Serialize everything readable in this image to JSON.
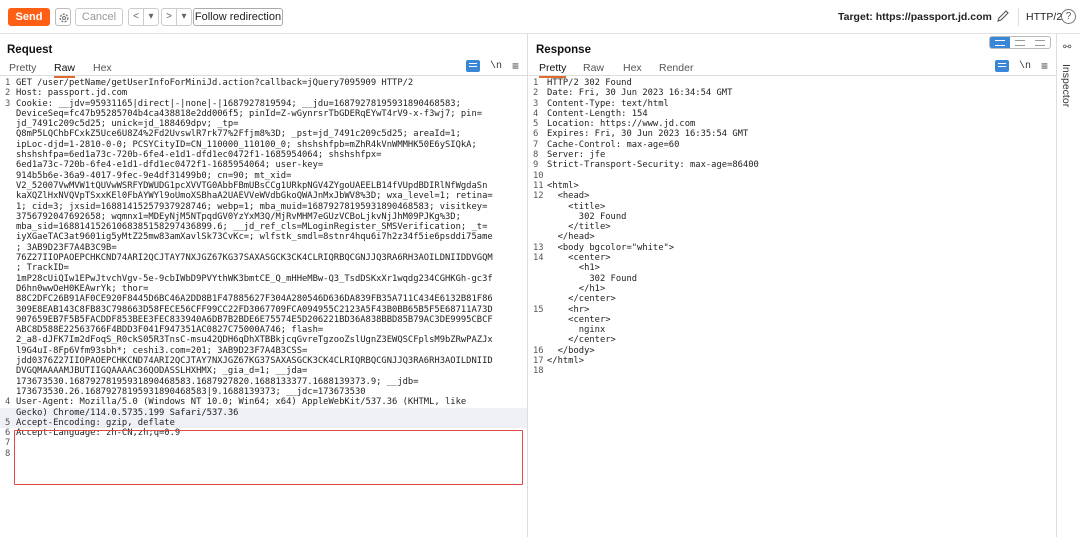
{
  "toolbar": {
    "send_label": "Send",
    "cancel_label": "Cancel",
    "back_label": "<",
    "back_dropdown": "|▾",
    "forward_label": ">",
    "forward_dropdown": "|▾",
    "follow_label": "Follow redirection",
    "target_text": "Target: https://passport.jd.com",
    "http_version": "HTTP/2",
    "help_label": "?"
  },
  "request": {
    "title": "Request",
    "tabs": [
      "Pretty",
      "Raw",
      "Hex"
    ],
    "active_tab": "Raw",
    "newline_label": "\\n",
    "menu_label": "≡",
    "lines": [
      {
        "n": "1",
        "t": "GET /user/petName/getUserInfoForMiniJd.action?callback=jQuery7095909 HTTP/2"
      },
      {
        "n": "2",
        "t": "Host: passport.jd.com"
      },
      {
        "n": "3",
        "t": "Cookie: __jdv=95931165|direct|-|none|-|1687927819594; __jdu=16879278195931890468583;"
      },
      {
        "n": "",
        "t": "DeviceSeq=fc47b95285704b4ca438818e2dd006f5; pinId=Z-wGynrsrTbGDERqEYwT4rV9-x-f3wj7; pin="
      },
      {
        "n": "",
        "t": "jd_7491c209c5d25; unick=jd_188469dpv; _tp="
      },
      {
        "n": "",
        "t": "Q8mP5LQChbFCxkZ5Uce6U8Z4%2Fd2UvswlR7rk77%2Ffjm8%3D; _pst=jd_7491c209c5d25; areaId=1;"
      },
      {
        "n": "",
        "t": "ipLoc-djd=1-2810-0-0; PCSYCityID=CN_110000_110100_0; shshshfpb=mZhR4kVnWMMHK50E6ySIQkA;"
      },
      {
        "n": "",
        "t": "shshshfpa=6ed1a73c-720b-6fe4-e1d1-dfd1ec0472f1-1685954064; shshshfpx="
      },
      {
        "n": "",
        "t": "6ed1a73c-720b-6fe4-e1d1-dfd1ec0472f1-1685954064; user-key="
      },
      {
        "n": "",
        "t": "914b5b6e-36a9-4017-9fec-9e4df31499b0; cn=90; mt_xid="
      },
      {
        "n": "",
        "t": "V2_52007VwMVW1tQUVwWSRFYDWUDG1pcXVVTG0AbbFBmUBsCCg1URkpNGV4ZYgoUAEELB14fVUpdBDIRlNfWgdaSn"
      },
      {
        "n": "",
        "t": "kaXQZlHxNVQVpTSxxKEl0FbAYWYl9oUmoXSBhaA2UAEVVeWVdbGkoQWAJnMxJbWV8%3D; wxa_level=1; retina="
      },
      {
        "n": "",
        "t": "1; cid=3; jxsid=16881415257937928746; webp=1; mba_muid=16879278195931890468583; visitkey="
      },
      {
        "n": "",
        "t": "3756792047692658; wqmnx1=MDEyNjM5NTpqdGV0YzYxM3Q/MjRvMHM7eGUzVCBoLjkvNjJhM09PJKg%3D;"
      },
      {
        "n": "",
        "t": "mba_sid=16881415261068385158297436899.6; __jd_ref_cls=MLoginRegister_SMSVerification; _t="
      },
      {
        "n": "",
        "t": "iyXGaeTAC3at9601ig5yMtZ25mw83amXavlSk73CvKc=; wlfstk_smdl=8stnr4hqu6i7h2z34f5ie6psddi75ame"
      },
      {
        "n": "",
        "t": "; 3AB9D23F7A4B3C9B="
      },
      {
        "n": "",
        "t": "76Z27IIOPAOEPCHKCND74ARI2QCJTAY7NXJGZ67KG37SAXASGCK3CK4CLRIQRBQCGNJJQ3RA6RH3AOILDNIIDDVGQM"
      },
      {
        "n": "",
        "t": "; TrackID="
      },
      {
        "n": "",
        "t": "1mP28cUiQIw1EPwJtvchVgv-5e-9cbIWbD9PVYthWK3bmtCE_Q_mHHeMBw-Q3_TsdDSKxXr1wqdg234CGHKGh-gc3f"
      },
      {
        "n": "",
        "t": "D6hn0wwOeH0KEAwrYk; thor="
      },
      {
        "n": "",
        "t": "88C2DFC26B91AF0CE920F8445D6BC46A2DD8B1F47885627F304A280546D636DA839FB35A711C434E6132B81F86"
      },
      {
        "n": "",
        "t": "309E8EAB143C8FB83C798663D58FECE56CFF99CC22FD3067709FCA094955C2123A5F43B0BB65B5F5E68711A73D"
      },
      {
        "n": "",
        "t": "907659EB7F5B5FACDDF853BEE3FEC833940A6DB7B2BDE6E75574E5D206221BD36A838BBD85B79AC3DE9995CBCF"
      },
      {
        "n": "",
        "t": "ABC8D588E22563766F4BDD3F041F947351AC0827C75000A746; flash="
      },
      {
        "n": "",
        "t": "2_a8-dJFK7Im2dFoqS_R0ckS05R3TnsC-msu42QDH6qDhXTBBkjcqGvreTgzooZslUgnZ3EWQSCFplsM9bZRwPAZJx"
      },
      {
        "n": "",
        "t": "l9G4uI-8Fp6Vfm93sbh*; ceshi3.com=201; 3AB9D23F7A4B3CSS="
      },
      {
        "n": "",
        "t": "jdd0376Z27IIOPAOEPCHKCND74ARI2QCJTAY7NXJGZ67KG37SAXASGCK3CK4CLRIQRBQCGNJJQ3RA6RH3AOILDNIID"
      },
      {
        "n": "",
        "t": "DVGQMAAAAMJBUTIIGQAAAAC36QODASSLHXHMX; _gia_d=1; __jda="
      },
      {
        "n": "",
        "t": "173673530.16879278195931890468583.1687927820.1688133377.1688139373.9; __jdb="
      },
      {
        "n": "",
        "t": "173673530.26.16879278195931890468583|9.1688139373; __jdc=173673530"
      },
      {
        "n": "4",
        "t": "User-Agent: Mozilla/5.0 (Windows NT 10.0; Win64; x64) AppleWebKit/537.36 (KHTML, like"
      },
      {
        "n": "",
        "t": "Gecko) Chrome/114.0.5735.199 Safari/537.36"
      },
      {
        "n": "5",
        "t": "Accept-Encoding: gzip, deflate"
      },
      {
        "n": "6",
        "t": "Accept-Language: zh-CN,zh;q=0.9"
      },
      {
        "n": "7",
        "t": ""
      },
      {
        "n": "8",
        "t": ""
      }
    ]
  },
  "response": {
    "title": "Response",
    "tabs": [
      "Pretty",
      "Raw",
      "Hex",
      "Render"
    ],
    "active_tab": "Pretty",
    "newline_label": "\\n",
    "menu_label": "≡",
    "lines": [
      {
        "n": "1",
        "t": "HTTP/2 302 Found"
      },
      {
        "n": "2",
        "t": "Date: Fri, 30 Jun 2023 16:34:54 GMT"
      },
      {
        "n": "3",
        "t": "Content-Type: text/html"
      },
      {
        "n": "4",
        "t": "Content-Length: 154"
      },
      {
        "n": "5",
        "t": "Location: https://www.jd.com"
      },
      {
        "n": "6",
        "t": "Expires: Fri, 30 Jun 2023 16:35:54 GMT"
      },
      {
        "n": "7",
        "t": "Cache-Control: max-age=60"
      },
      {
        "n": "8",
        "t": "Server: jfe"
      },
      {
        "n": "9",
        "t": "Strict-Transport-Security: max-age=86400"
      },
      {
        "n": "10",
        "t": ""
      },
      {
        "n": "11",
        "t": "<html>"
      },
      {
        "n": "12",
        "t": "  <head>"
      },
      {
        "n": "",
        "t": "    <title>"
      },
      {
        "n": "",
        "t": "      302 Found"
      },
      {
        "n": "",
        "t": "    </title>"
      },
      {
        "n": "",
        "t": "  </head>"
      },
      {
        "n": "13",
        "t": "  <body bgcolor=\"white\">"
      },
      {
        "n": "14",
        "t": "    <center>"
      },
      {
        "n": "",
        "t": "      <h1>"
      },
      {
        "n": "",
        "t": "        302 Found"
      },
      {
        "n": "",
        "t": "      </h1>"
      },
      {
        "n": "",
        "t": "    </center>"
      },
      {
        "n": "15",
        "t": "    <hr>"
      },
      {
        "n": "",
        "t": "    <center>"
      },
      {
        "n": "",
        "t": "      nginx"
      },
      {
        "n": "",
        "t": "    </center>"
      },
      {
        "n": "16",
        "t": "  </body>"
      },
      {
        "n": "17",
        "t": "</html>"
      },
      {
        "n": "18",
        "t": ""
      }
    ]
  },
  "inspector": {
    "label": "Inspector"
  },
  "colors": {
    "accent": "#ff5f15",
    "tab_underline": "#e06a2c",
    "highlight_box": "#e04848",
    "icon_blue": "#3a87d8"
  }
}
